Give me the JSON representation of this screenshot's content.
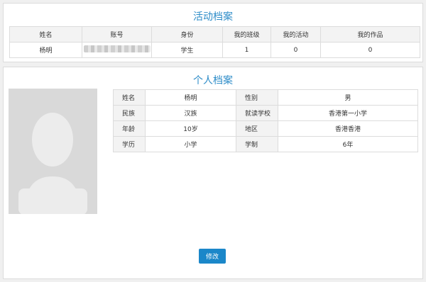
{
  "activity": {
    "title": "活动档案",
    "headers": [
      "姓名",
      "账号",
      "身份",
      "我的班级",
      "我的活动",
      "我的作品"
    ],
    "row": {
      "name": "杨明",
      "account": "",
      "role": "学生",
      "class_count": "1",
      "activity_count": "0",
      "works_count": "0"
    }
  },
  "profile": {
    "title": "个人档案",
    "rows": [
      {
        "label1": "姓名",
        "value1": "杨明",
        "label2": "性别",
        "value2": "男"
      },
      {
        "label1": "民族",
        "value1": "汉族",
        "label2": "就读学校",
        "value2": "香港第一小学"
      },
      {
        "label1": "年龄",
        "value1": "10岁",
        "label2": "地区",
        "value2": "香港香港"
      },
      {
        "label1": "学历",
        "value1": "小学",
        "label2": "学制",
        "value2": "6年"
      }
    ],
    "edit_label": "修改"
  },
  "icons": {
    "avatar": "person-silhouette-icon"
  },
  "colors": {
    "accent": "#2d8cc8",
    "button": "#1b87c9"
  }
}
